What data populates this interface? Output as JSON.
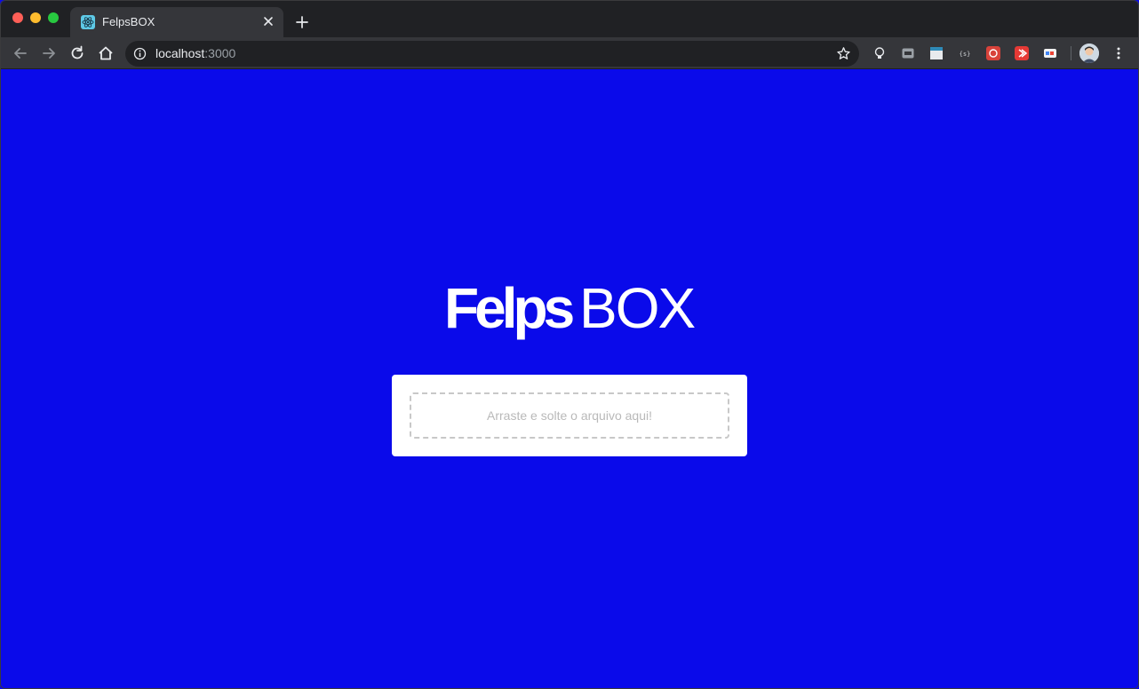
{
  "browser": {
    "tab": {
      "title": "FelpsBOX"
    },
    "address_bar": {
      "host": "localhost",
      "port": ":3000"
    }
  },
  "page": {
    "logo": {
      "bold_part": "Felps",
      "light_part": "BOX"
    },
    "dropzone": {
      "label": "Arraste e solte o arquivo aqui!"
    }
  },
  "colors": {
    "page_background": "#0a0aea",
    "card_background": "#ffffff",
    "dropzone_border": "#c8c8c8",
    "dropzone_text": "#b9b9b9"
  }
}
